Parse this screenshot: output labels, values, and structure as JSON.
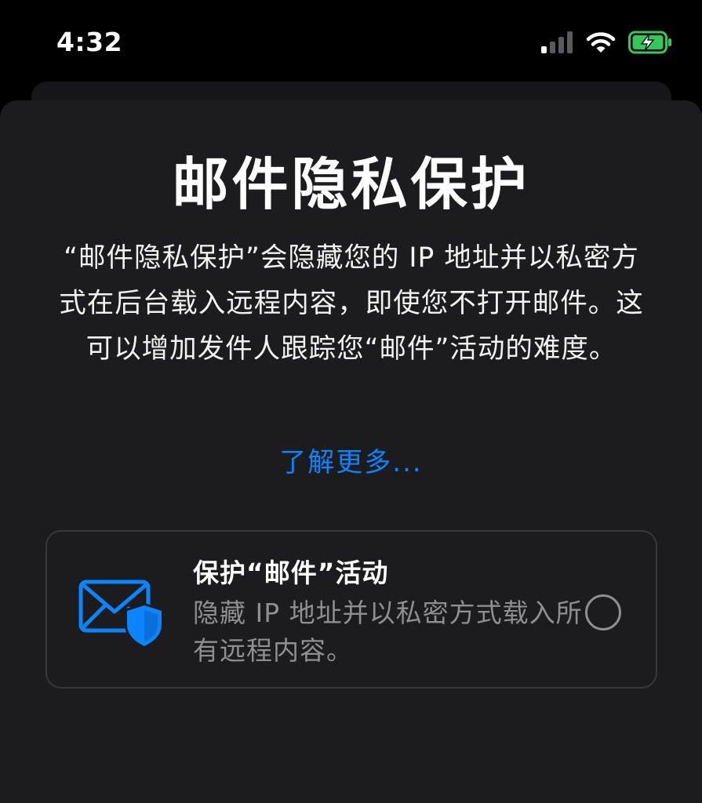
{
  "status_bar": {
    "time": "4:32"
  },
  "sheet": {
    "title": "邮件隐私保护",
    "description": "“邮件隐私保护”会隐藏您的 IP 地址并以私密方式在后台载入远程内容，即使您不打开邮件。这可以增加发件人跟踪您“邮件”活动的难度。",
    "learn_more": "了解更多..."
  },
  "option": {
    "title": "保护“邮件”活动",
    "description": "隐藏 IP 地址并以私密方式载入所有远程内容。",
    "selected": false,
    "icon": "mail-shield-icon"
  },
  "colors": {
    "accent": "#0a84ff",
    "battery_charge": "#34c759",
    "sheet_background": "#1c1c1e",
    "secondary_text": "#8e8e93"
  }
}
